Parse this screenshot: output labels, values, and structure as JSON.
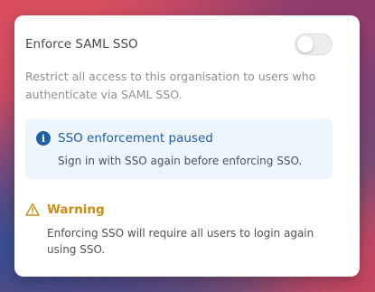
{
  "setting": {
    "title": "Enforce SAML SSO",
    "toggle_state": "off",
    "description": "Restrict all access to this organisation to users who authenticate via SAML SSO."
  },
  "info_banner": {
    "icon": "info-circle-icon",
    "title": "SSO enforcement paused",
    "text": "Sign in with SSO again before enforcing SSO.",
    "color": "#1f5fa8",
    "background": "#eef5fc"
  },
  "warning": {
    "icon": "warning-triangle-icon",
    "title": "Warning",
    "text": "Enforcing SSO will require all users to login again using SSO.",
    "color": "#c98d12"
  }
}
